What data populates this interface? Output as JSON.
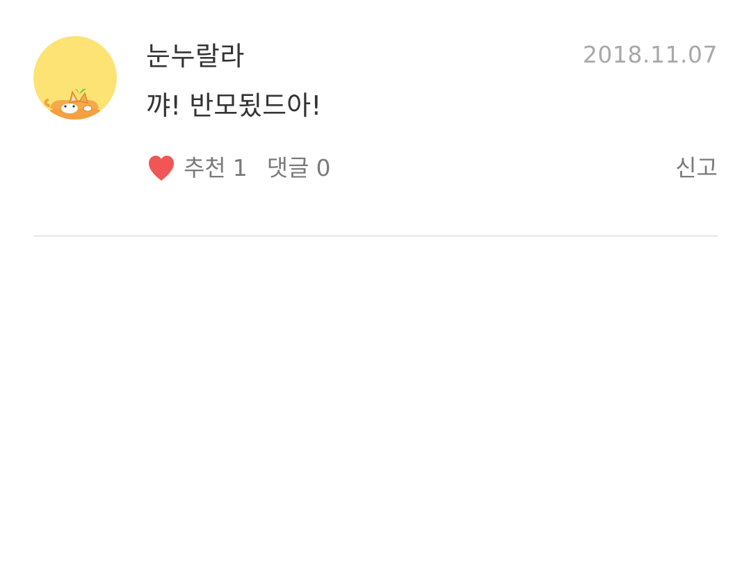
{
  "comment": {
    "author": "눈누랄라",
    "date": "2018.11.07",
    "text": "꺄! 반모됬드아!",
    "avatar_icon": "corgi-avatar-icon",
    "like_label": "추천",
    "like_count": "1",
    "reply_label": "댓글",
    "reply_count": "0",
    "report_label": "신고"
  },
  "colors": {
    "avatar_bg": "#fde374",
    "heart": "#f25555",
    "primary_text": "#333333",
    "muted_text": "#a8a8a8"
  }
}
